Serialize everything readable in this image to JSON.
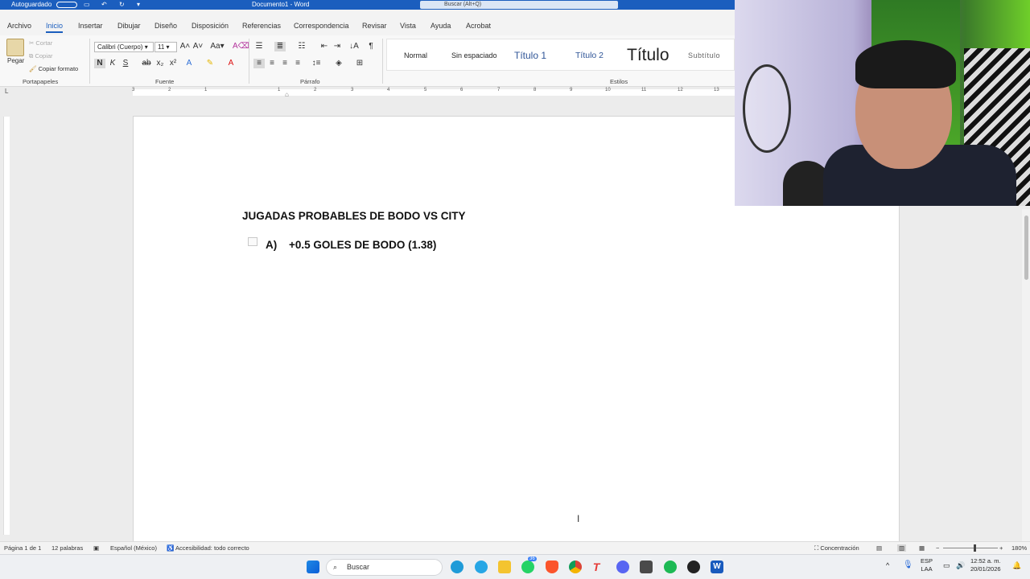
{
  "titlebar": {
    "autosave": "Autoguardado",
    "doc_title": "Documento1  -  Word",
    "search_placeholder": "Buscar (Alt+Q)"
  },
  "tabs": [
    "Archivo",
    "Inicio",
    "Insertar",
    "Dibujar",
    "Diseño",
    "Disposición",
    "Referencias",
    "Correspondencia",
    "Revisar",
    "Vista",
    "Ayuda",
    "Acrobat"
  ],
  "ribbon": {
    "clipboard": {
      "paste": "Pegar",
      "cut": "Cortar",
      "copy": "Copiar",
      "format_painter": "Copiar formato",
      "label": "Portapapeles"
    },
    "font": {
      "name": "Calibri (Cuerpo)",
      "size": "11",
      "label": "Fuente",
      "bold": "N",
      "italic": "K",
      "underline": "S"
    },
    "paragraph": {
      "label": "Párrafo"
    },
    "styles": {
      "label": "Estilos",
      "items": [
        "Normal",
        "Sin espaciado",
        "Título 1",
        "Título 2",
        "Título",
        "Subtítulo"
      ]
    }
  },
  "ruler": {
    "numbers": [
      "3",
      "2",
      "1",
      "1",
      "2",
      "3",
      "4",
      "5",
      "6",
      "7",
      "8",
      "9",
      "10",
      "11",
      "12",
      "13"
    ]
  },
  "document": {
    "heading": "JUGADAS PROBABLES DE BODO VS CITY",
    "list_number": "A)",
    "list_text": "+0.5 GOLES DE BODO (1.38)"
  },
  "statusbar": {
    "page": "Página 1 de 1",
    "words": "12 palabras",
    "language": "Español (México)",
    "accessibility": "Accesibilidad: todo correcto",
    "focus": "Concentración",
    "zoom": "180%"
  },
  "taskbar": {
    "search": "Buscar",
    "badge": "36",
    "lang_top": "ESP",
    "lang_bottom": "LAA",
    "time": "12:52 a. m.",
    "date": "20/01/2026"
  }
}
